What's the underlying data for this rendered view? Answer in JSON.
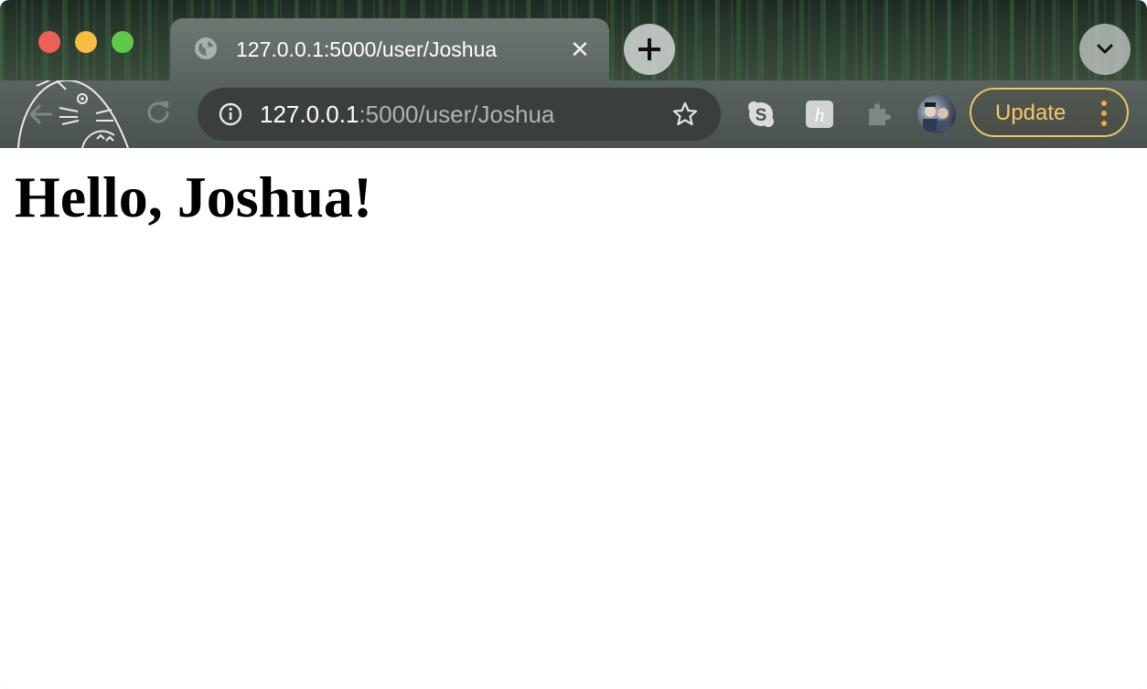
{
  "browser": {
    "tab": {
      "title": "127.0.0.1:5000/user/Joshua",
      "favicon": "globe-icon",
      "close_glyph": "✕"
    },
    "address_bar": {
      "host": "127.0.0.1",
      "path": ":5000/user/Joshua"
    },
    "toolbar": {
      "update_label": "Update"
    },
    "extensions": [
      "skype-icon",
      "honey-icon",
      "extensions-puzzle-icon"
    ],
    "theme_colors": {
      "update_accent": "#f5c86b",
      "menu_dots": "#f5a640"
    }
  },
  "page": {
    "heading": "Hello, Joshua!"
  }
}
